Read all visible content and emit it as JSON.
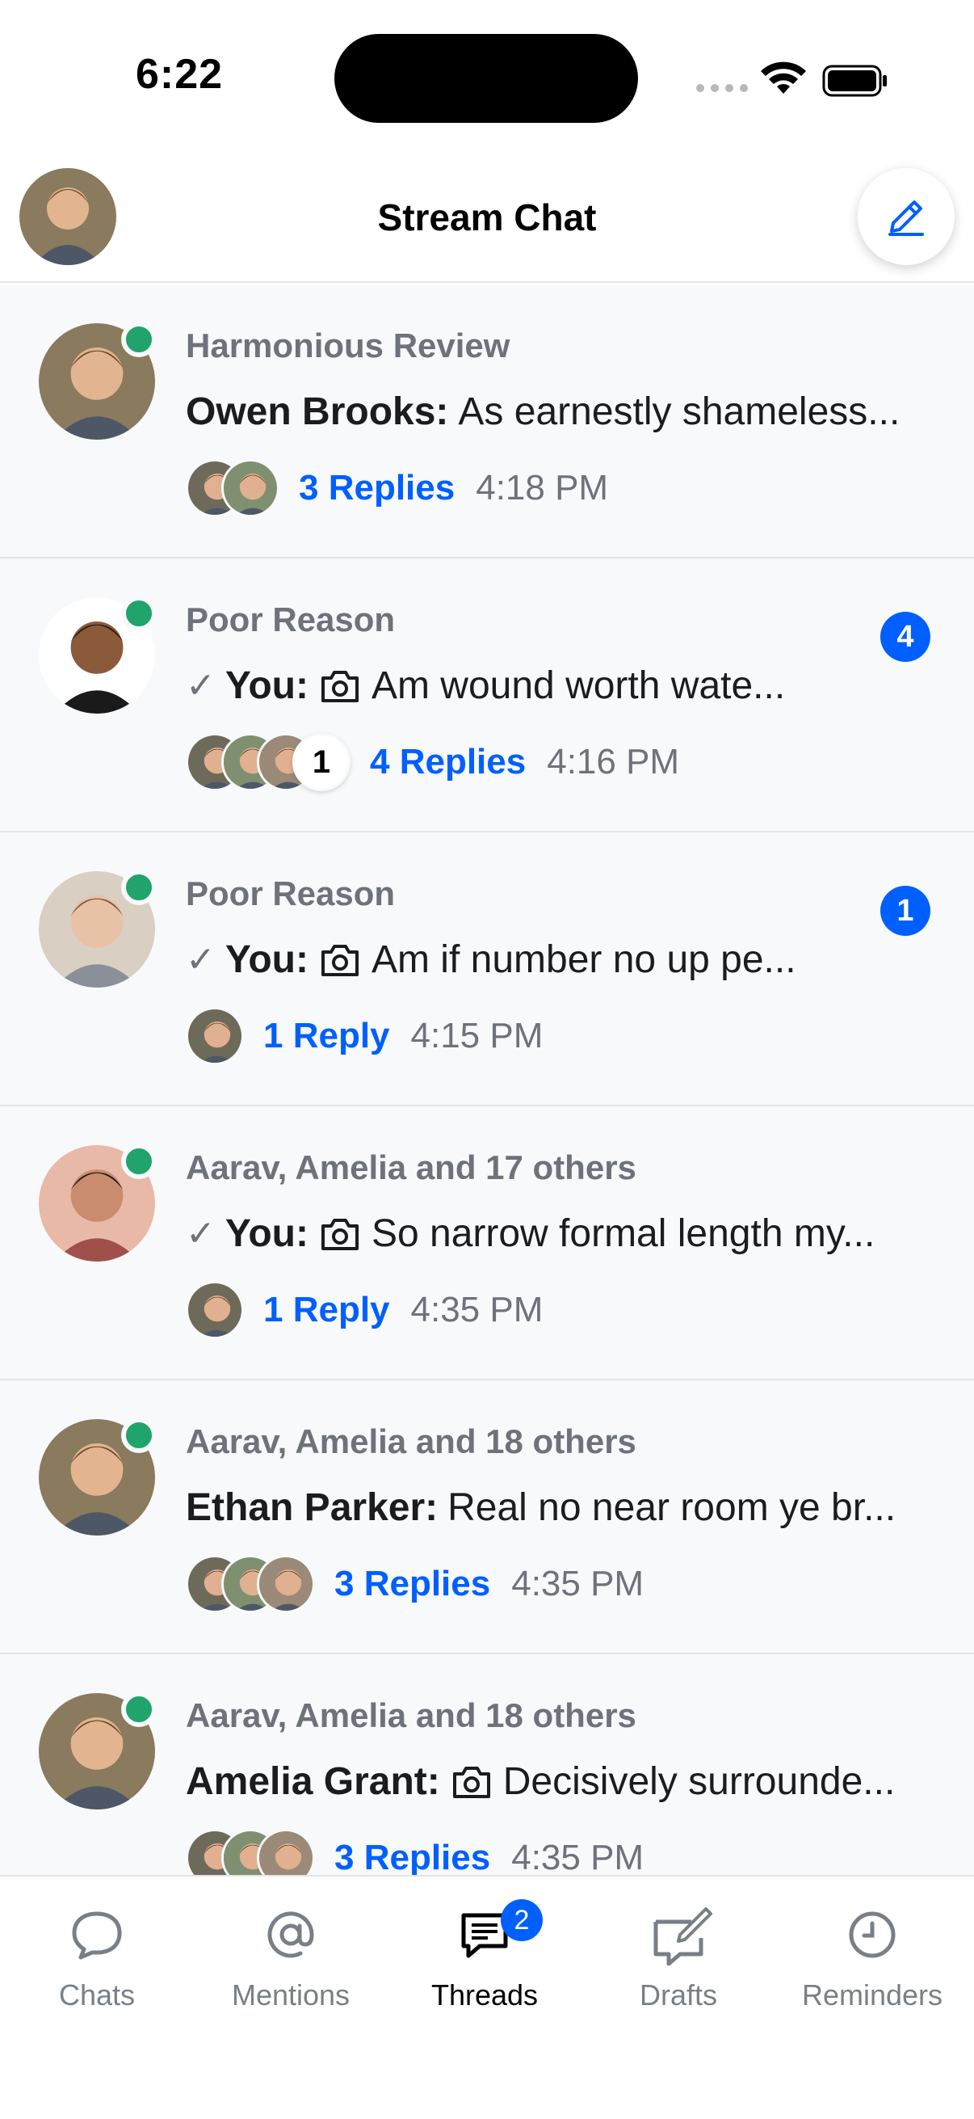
{
  "status_bar": {
    "time": "6:22"
  },
  "header": {
    "title": "Stream Chat"
  },
  "threads": [
    {
      "channel": "Harmonious Review",
      "prefix": "Owen Brooks:",
      "check": false,
      "photo": false,
      "message": "As earnestly shameless...",
      "replies": "3 Replies",
      "time": "4:18 PM",
      "participants": 2,
      "extra": "",
      "unread": ""
    },
    {
      "channel": "Poor Reason",
      "prefix": "You:",
      "check": true,
      "photo": true,
      "message": "Am wound worth wate...",
      "replies": "4 Replies",
      "time": "4:16 PM",
      "participants": 3,
      "extra": "1",
      "unread": "4"
    },
    {
      "channel": "Poor Reason",
      "prefix": "You:",
      "check": true,
      "photo": true,
      "message": "Am if number no up pe...",
      "replies": "1 Reply",
      "time": "4:15 PM",
      "participants": 1,
      "extra": "",
      "unread": "1"
    },
    {
      "channel": "Aarav, Amelia and 17 others",
      "prefix": "You:",
      "check": true,
      "photo": true,
      "message": "So narrow formal length my...",
      "replies": "1 Reply",
      "time": "4:35 PM",
      "participants": 1,
      "extra": "",
      "unread": ""
    },
    {
      "channel": "Aarav, Amelia and 18 others",
      "prefix": "Ethan Parker:",
      "check": false,
      "photo": false,
      "message": "Real no near room ye br...",
      "replies": "3 Replies",
      "time": "4:35 PM",
      "participants": 3,
      "extra": "",
      "unread": ""
    },
    {
      "channel": "Aarav, Amelia and 18 others",
      "prefix": "Amelia Grant:",
      "check": false,
      "photo": true,
      "message": "Decisively surrounde...",
      "replies": "3 Replies",
      "time": "4:35 PM",
      "participants": 3,
      "extra": "",
      "unread": ""
    }
  ],
  "tabs": [
    {
      "label": "Chats",
      "icon": "chat-bubble-icon",
      "badge": ""
    },
    {
      "label": "Mentions",
      "icon": "at-sign-icon",
      "badge": ""
    },
    {
      "label": "Threads",
      "icon": "threads-icon",
      "badge": "2"
    },
    {
      "label": "Drafts",
      "icon": "draft-icon",
      "badge": ""
    },
    {
      "label": "Reminders",
      "icon": "clock-icon",
      "badge": ""
    }
  ],
  "colors": {
    "accent": "#005fff",
    "online": "#20a46b",
    "muted": "#6d727b",
    "row_bg": "#f8f9fa"
  }
}
